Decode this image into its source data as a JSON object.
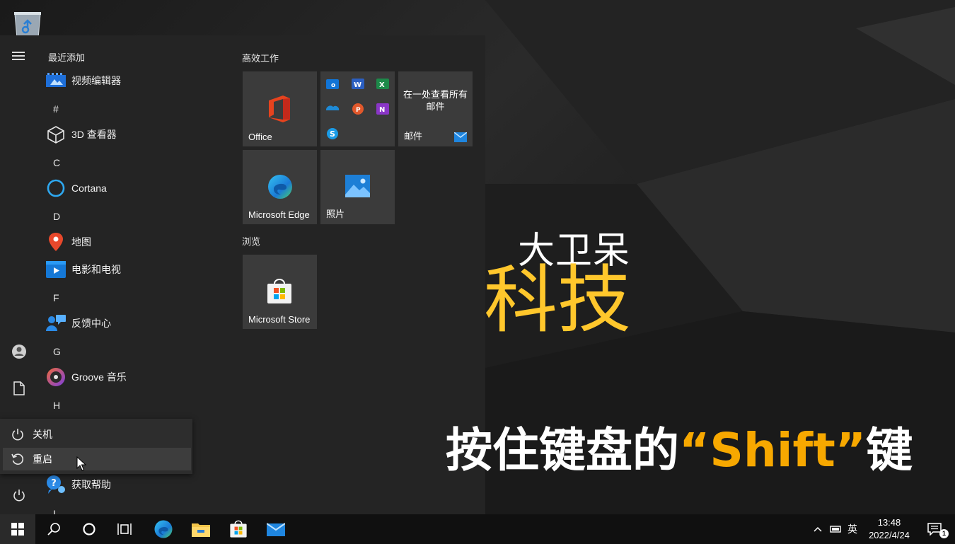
{
  "start_menu": {
    "section_title": "最近添加",
    "apps": [
      {
        "type": "app",
        "label": "视频编辑器",
        "icon": "video-editor-icon"
      },
      {
        "type": "letter",
        "label": "#"
      },
      {
        "type": "app",
        "label": "3D 查看器",
        "icon": "3d-viewer-icon"
      },
      {
        "type": "letter",
        "label": "C"
      },
      {
        "type": "app",
        "label": "Cortana",
        "icon": "cortana-icon"
      },
      {
        "type": "letter",
        "label": "D"
      },
      {
        "type": "app",
        "label": "地图",
        "icon": "maps-icon"
      },
      {
        "type": "app",
        "label": "电影和电视",
        "icon": "movies-tv-icon"
      },
      {
        "type": "letter",
        "label": "F"
      },
      {
        "type": "app",
        "label": "反馈中心",
        "icon": "feedback-hub-icon"
      },
      {
        "type": "letter",
        "label": "G"
      },
      {
        "type": "app",
        "label": "Groove 音乐",
        "icon": "groove-music-icon"
      },
      {
        "type": "letter",
        "label": "H"
      },
      {
        "type": "app",
        "label": "获取帮助",
        "icon": "get-help-icon"
      },
      {
        "type": "letter",
        "label": "I"
      }
    ],
    "tile_groups": [
      {
        "title": "高效工作"
      },
      {
        "title": "浏览"
      }
    ],
    "tiles": {
      "office": "Office",
      "mail_text": "在一处查看所有邮件",
      "mail_label": "邮件",
      "edge": "Microsoft Edge",
      "photos": "照片",
      "store": "Microsoft Store"
    },
    "power_menu": {
      "shutdown": "关机",
      "restart": "重启"
    }
  },
  "overlay": {
    "brand_line1": "大卫呆",
    "brand_line2": "科技",
    "caption_prefix": "按住键盘的",
    "caption_highlight": "“Shift”",
    "caption_suffix": "键"
  },
  "taskbar": {
    "ime": "英",
    "time": "13:48",
    "date": "2022/4/24",
    "notification_count": "1"
  },
  "colors": {
    "accent_yellow": "#ffc72c",
    "caption_orange": "#f7a800",
    "start_bg": "#242424",
    "tile_bg": "#3b3b3b"
  }
}
